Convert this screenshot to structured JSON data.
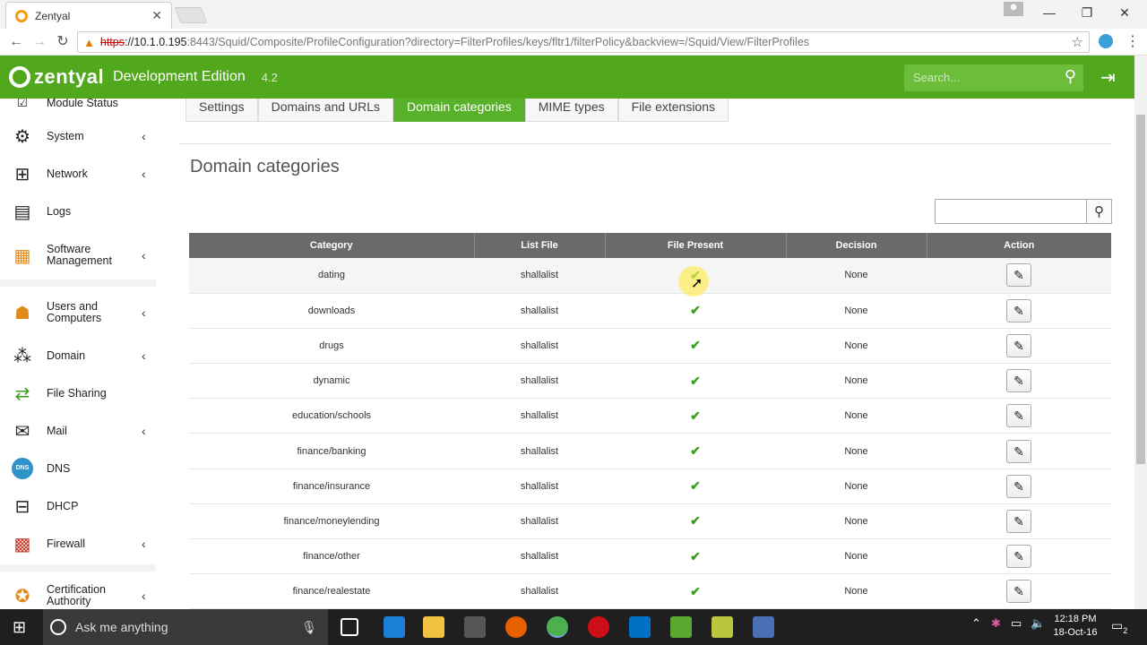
{
  "browser": {
    "tab_title": "Zentyal",
    "tab_close": "✕",
    "url_scheme": "https",
    "url_host": "://10.1.0.195",
    "url_path": ":8443/Squid/Composite/ProfileConfiguration?directory=FilterProfiles/keys/fltr1/filterPolicy&backview=/Squid/View/FilterProfiles"
  },
  "header": {
    "brand": "zentyal",
    "edition": "Development Edition",
    "version": "4.2",
    "search_placeholder": "Search..."
  },
  "sidebar": {
    "items": [
      {
        "label": "Module Status",
        "icon": "module-status-icon"
      },
      {
        "label": "System",
        "icon": "gear-icon",
        "chevron": "‹"
      },
      {
        "label": "Network",
        "icon": "network-icon",
        "chevron": "‹"
      },
      {
        "label": "Logs",
        "icon": "logs-icon"
      },
      {
        "label": "Software Management",
        "icon": "package-icon",
        "chevron": "‹"
      },
      {
        "label": "Users and Computers",
        "icon": "users-icon",
        "chevron": "‹"
      },
      {
        "label": "Domain",
        "icon": "domain-icon",
        "chevron": "‹"
      },
      {
        "label": "File Sharing",
        "icon": "file-sharing-icon"
      },
      {
        "label": "Mail",
        "icon": "mail-icon",
        "chevron": "‹"
      },
      {
        "label": "DNS",
        "icon": "dns-icon"
      },
      {
        "label": "DHCP",
        "icon": "dhcp-icon"
      },
      {
        "label": "Firewall",
        "icon": "firewall-icon",
        "chevron": "‹"
      },
      {
        "label": "Certification Authority",
        "icon": "certificate-icon",
        "chevron": "‹"
      }
    ]
  },
  "tabs": [
    {
      "label": "Settings",
      "active": false
    },
    {
      "label": "Domains and URLs",
      "active": false
    },
    {
      "label": "Domain categories",
      "active": true
    },
    {
      "label": "MIME types",
      "active": false
    },
    {
      "label": "File extensions",
      "active": false
    }
  ],
  "page_title": "Domain categories",
  "table": {
    "headers": [
      "Category",
      "List File",
      "File Present",
      "Decision",
      "Action"
    ],
    "rows": [
      {
        "category": "dating",
        "list_file": "shallalist",
        "file_present": "✔",
        "decision": "None"
      },
      {
        "category": "downloads",
        "list_file": "shallalist",
        "file_present": "✔",
        "decision": "None"
      },
      {
        "category": "drugs",
        "list_file": "shallalist",
        "file_present": "✔",
        "decision": "None"
      },
      {
        "category": "dynamic",
        "list_file": "shallalist",
        "file_present": "✔",
        "decision": "None"
      },
      {
        "category": "education/schools",
        "list_file": "shallalist",
        "file_present": "✔",
        "decision": "None"
      },
      {
        "category": "finance/banking",
        "list_file": "shallalist",
        "file_present": "✔",
        "decision": "None"
      },
      {
        "category": "finance/insurance",
        "list_file": "shallalist",
        "file_present": "✔",
        "decision": "None"
      },
      {
        "category": "finance/moneylending",
        "list_file": "shallalist",
        "file_present": "✔",
        "decision": "None"
      },
      {
        "category": "finance/other",
        "list_file": "shallalist",
        "file_present": "✔",
        "decision": "None"
      },
      {
        "category": "finance/realestate",
        "list_file": "shallalist",
        "file_present": "✔",
        "decision": "None"
      }
    ]
  },
  "taskbar": {
    "search_placeholder": "Ask me anything",
    "time": "12:18 PM",
    "date": "18-Oct-16",
    "notifications": "2"
  },
  "colors": {
    "brand_green": "#51a81c",
    "active_tab": "#58b12a",
    "table_header": "#6a6a6a",
    "check": "#3aa11f"
  }
}
